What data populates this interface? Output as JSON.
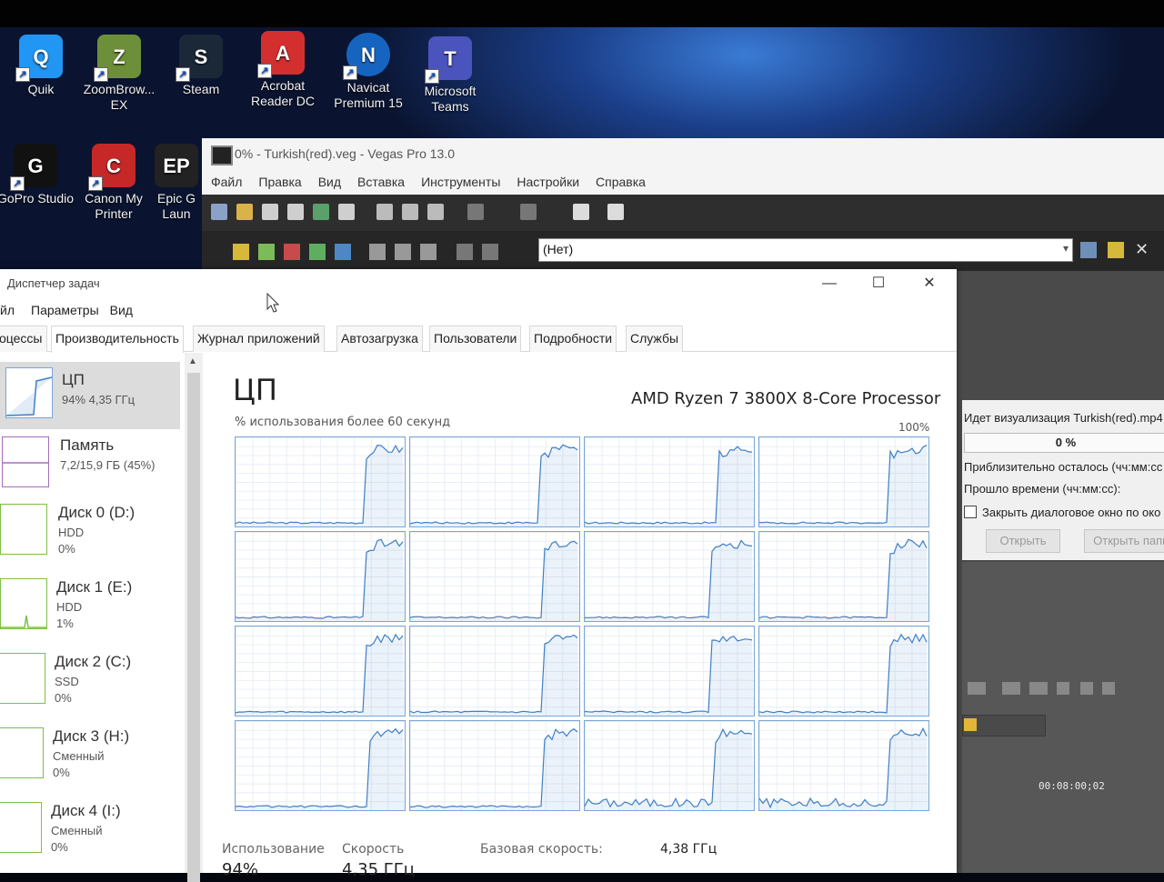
{
  "desktop_icons": [
    {
      "label": "Quik",
      "color": "#2196f3",
      "icon": "quik-icon",
      "glyph": "Q"
    },
    {
      "label": "ZoomBrow... EX",
      "color": "#6d8f3a",
      "icon": "zoombrowser-icon",
      "glyph": "Z"
    },
    {
      "label": "Steam",
      "color": "#1b2838",
      "icon": "steam-icon",
      "glyph": "S"
    },
    {
      "label": "Acrobat Reader DC",
      "color": "#d32f2f",
      "icon": "acrobat-icon",
      "glyph": "A"
    },
    {
      "label": "Navicat Premium 15",
      "color": "#1565c0",
      "icon": "navicat-icon",
      "glyph": "N"
    },
    {
      "label": "Microsoft Teams",
      "color": "#4b53bc",
      "icon": "teams-icon",
      "glyph": "T"
    },
    {
      "label": "GoPro Studio",
      "color": "#111111",
      "icon": "gopro-icon",
      "glyph": "G"
    },
    {
      "label": "Canon My Printer",
      "color": "#c62828",
      "icon": "canon-printer-icon",
      "glyph": "C"
    },
    {
      "label": "Epic G Laun",
      "color": "#222222",
      "icon": "epic-games-icon",
      "glyph": "EP"
    }
  ],
  "vegas": {
    "title": "0% - Turkish(red).veg - Vegas Pro 13.0",
    "menu": [
      "Файл",
      "Правка",
      "Вид",
      "Вставка",
      "Инструменты",
      "Настройки",
      "Справка"
    ],
    "combo_value": "(Нет)",
    "render_panel": {
      "rendering_label": "Идет визуализация Turkish(red).mp4",
      "progress": "0 %",
      "progress_fraction": 0.0,
      "remaining_label": "Приблизительно осталось (чч:мм:сс",
      "elapsed_label": "Прошло времени (чч:мм:сс):",
      "close_checkbox_label": "Закрыть диалоговое окно по око",
      "open_button": "Открыть",
      "open_folder_button": "Открыть папк"
    },
    "timecode": "00:08:00;02"
  },
  "taskmanager": {
    "title": "Диспетчер задач",
    "menu": [
      "йл",
      "Параметры",
      "Вид"
    ],
    "tabs": [
      "оцессы",
      "Производительность",
      "Журнал приложений",
      "Автозагрузка",
      "Пользователи",
      "Подробности",
      "Службы"
    ],
    "active_tab": "Производительность",
    "sidebar": [
      {
        "name": "ЦП",
        "line1": "94% 4,35 ГГц",
        "line2": "",
        "kind": "cpu",
        "level": 0.94
      },
      {
        "name": "Память",
        "line1": "7,2/15,9 ГБ (45%)",
        "line2": "",
        "kind": "mem",
        "level": 0.45
      },
      {
        "name": "Диск 0 (D:)",
        "line1": "HDD",
        "line2": "0%",
        "kind": "disk",
        "level": 0.0
      },
      {
        "name": "Диск 1 (E:)",
        "line1": "HDD",
        "line2": "1%",
        "kind": "disk",
        "level": 0.01
      },
      {
        "name": "Диск 2 (C:)",
        "line1": "SSD",
        "line2": "0%",
        "kind": "disk",
        "level": 0.0
      },
      {
        "name": "Диск 3 (H:)",
        "line1": "Сменный",
        "line2": "0%",
        "kind": "disk",
        "level": 0.0
      },
      {
        "name": "Диск 4 (I:)",
        "line1": "Сменный",
        "line2": "0%",
        "kind": "disk",
        "level": 0.0
      }
    ],
    "cpu": {
      "title": "ЦП",
      "processor": "AMD Ryzen 7 3800X 8-Core Processor",
      "axis_label": "% использования более 60 секунд",
      "max_label": "100%",
      "logical_cores": 16,
      "stats": {
        "usage_label": "Использование",
        "speed_label": "Скорость",
        "base_speed_label": "Базовая скорость:",
        "base_speed_value": "4,38 ГГц",
        "usage_value": "94%",
        "speed_value": "4,35 ГГц"
      }
    }
  },
  "colors": {
    "cpu_line": "#3f7fc4",
    "memory_line": "#a66bbd",
    "disk_line": "#7cbf49",
    "selected_bg": "#dcdcdc"
  }
}
